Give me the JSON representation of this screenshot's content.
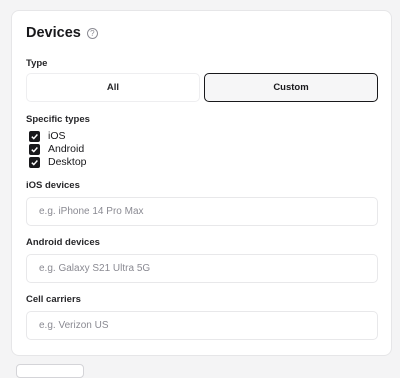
{
  "section": {
    "title": "Devices",
    "help_icon": "?"
  },
  "type": {
    "label": "Type",
    "options": [
      "All",
      "Custom"
    ],
    "selected": "Custom"
  },
  "specific_types": {
    "label": "Specific types",
    "items": [
      {
        "label": "iOS",
        "checked": true
      },
      {
        "label": "Android",
        "checked": true
      },
      {
        "label": "Desktop",
        "checked": true
      }
    ]
  },
  "ios_devices": {
    "label": "iOS devices",
    "placeholder": "e.g. iPhone 14 Pro Max",
    "value": ""
  },
  "android_devices": {
    "label": "Android devices",
    "placeholder": "e.g. Galaxy S21 Ultra 5G",
    "value": ""
  },
  "cell_carriers": {
    "label": "Cell carriers",
    "placeholder": "e.g. Verizon US",
    "value": ""
  },
  "colors": {
    "text": "#18181b",
    "border": "#e8e8ea",
    "selected_border": "#18181b",
    "checkbox": "#18181b"
  }
}
